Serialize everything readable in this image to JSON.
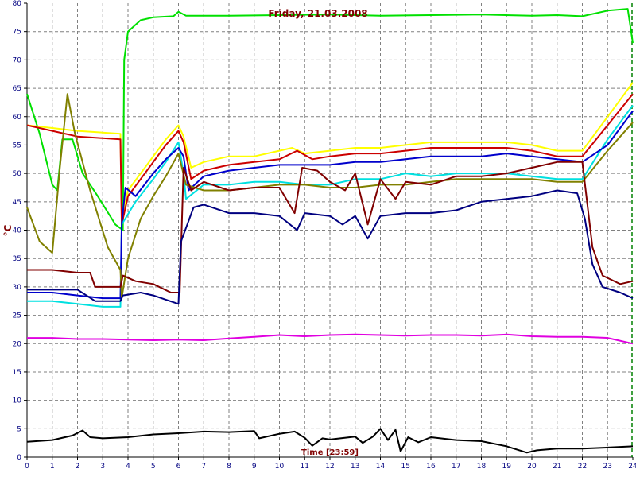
{
  "chart_data": {
    "type": "line",
    "title": "Friday, 21.03.2008",
    "xlabel": "Time [23:59]",
    "ylabel": "°C",
    "xlim": [
      0,
      24
    ],
    "ylim": [
      0,
      80
    ],
    "grid": true,
    "x_ticks": [
      "0",
      "1",
      "2",
      "3",
      "4",
      "5",
      "6",
      "7",
      "8",
      "9",
      "10",
      "11",
      "12",
      "13",
      "14",
      "15",
      "16",
      "17",
      "18",
      "19",
      "20",
      "21",
      "22",
      "23",
      "24"
    ],
    "y_ticks": [
      "0",
      "5",
      "10",
      "15",
      "20",
      "25",
      "30",
      "35",
      "40",
      "45",
      "50",
      "55",
      "60",
      "65",
      "70",
      "75",
      "80"
    ],
    "marker_x": 24,
    "series": [
      {
        "color": "#00e000",
        "points": [
          [
            0,
            64
          ],
          [
            0.5,
            57
          ],
          [
            1,
            48
          ],
          [
            1.2,
            47
          ],
          [
            1.4,
            56
          ],
          [
            1.8,
            56
          ],
          [
            2.2,
            50
          ],
          [
            2.8,
            46
          ],
          [
            3.5,
            41
          ],
          [
            3.8,
            40
          ],
          [
            3.85,
            70
          ],
          [
            4.0,
            75
          ],
          [
            4.5,
            77
          ],
          [
            5,
            77.5
          ],
          [
            5.8,
            77.7
          ],
          [
            6,
            78.5
          ],
          [
            6.3,
            77.8
          ],
          [
            8,
            77.8
          ],
          [
            10,
            77.9
          ],
          [
            12,
            78
          ],
          [
            14,
            77.8
          ],
          [
            16,
            77.9
          ],
          [
            18,
            78
          ],
          [
            20,
            77.8
          ],
          [
            21,
            77.9
          ],
          [
            22,
            77.7
          ],
          [
            23,
            78.7
          ],
          [
            23.8,
            79
          ],
          [
            24,
            73
          ]
        ]
      },
      {
        "color": "#ffff00",
        "points": [
          [
            0,
            58.5
          ],
          [
            1,
            58
          ],
          [
            2,
            57.5
          ],
          [
            3.7,
            57
          ],
          [
            3.75,
            42
          ],
          [
            4,
            47
          ],
          [
            4.5,
            50
          ],
          [
            5,
            53
          ],
          [
            5.5,
            56
          ],
          [
            6,
            58.5
          ],
          [
            6.2,
            56.5
          ],
          [
            6.5,
            51
          ],
          [
            7,
            52
          ],
          [
            8,
            53
          ],
          [
            9,
            53
          ],
          [
            10,
            54
          ],
          [
            10.5,
            54.5
          ],
          [
            11,
            53.5
          ],
          [
            12,
            54
          ],
          [
            13,
            54.5
          ],
          [
            14,
            54.5
          ],
          [
            15,
            55
          ],
          [
            16,
            55.5
          ],
          [
            17,
            55.5
          ],
          [
            18,
            55.5
          ],
          [
            19,
            55.5
          ],
          [
            20,
            55
          ],
          [
            21,
            54
          ],
          [
            22,
            54
          ],
          [
            23,
            60
          ],
          [
            24,
            66
          ]
        ]
      },
      {
        "color": "#cc0000",
        "points": [
          [
            0,
            58.5
          ],
          [
            1,
            57.5
          ],
          [
            2,
            56.5
          ],
          [
            3.7,
            56
          ],
          [
            3.75,
            41
          ],
          [
            4,
            46
          ],
          [
            4.5,
            49
          ],
          [
            5,
            52
          ],
          [
            5.5,
            55
          ],
          [
            6,
            57.5
          ],
          [
            6.2,
            55.5
          ],
          [
            6.5,
            49
          ],
          [
            7,
            50.5
          ],
          [
            8,
            51.5
          ],
          [
            9,
            52
          ],
          [
            10,
            52.5
          ],
          [
            10.7,
            54
          ],
          [
            11.3,
            52.5
          ],
          [
            12,
            53
          ],
          [
            13,
            53.5
          ],
          [
            14,
            53.5
          ],
          [
            15,
            54
          ],
          [
            16,
            54.5
          ],
          [
            17,
            54.5
          ],
          [
            18,
            54.5
          ],
          [
            19,
            54.5
          ],
          [
            20,
            54
          ],
          [
            21,
            53
          ],
          [
            22,
            53
          ],
          [
            23,
            58.5
          ],
          [
            24,
            64
          ]
        ]
      },
      {
        "color": "#00e0e0",
        "points": [
          [
            0,
            27.5
          ],
          [
            1,
            27.5
          ],
          [
            2,
            27
          ],
          [
            3,
            26.5
          ],
          [
            3.7,
            26.5
          ],
          [
            3.75,
            41
          ],
          [
            4.3,
            45
          ],
          [
            5,
            49
          ],
          [
            5.5,
            52
          ],
          [
            6,
            55.5
          ],
          [
            6.2,
            50
          ],
          [
            6.3,
            45.5
          ],
          [
            7,
            48
          ],
          [
            8,
            48
          ],
          [
            9,
            48.5
          ],
          [
            10,
            48.5
          ],
          [
            11,
            48
          ],
          [
            12,
            48
          ],
          [
            13,
            49
          ],
          [
            14,
            49
          ],
          [
            15,
            50
          ],
          [
            16,
            49.5
          ],
          [
            17,
            50
          ],
          [
            18,
            50
          ],
          [
            19,
            50
          ],
          [
            20,
            49.5
          ],
          [
            21,
            49
          ],
          [
            22,
            49
          ],
          [
            23,
            56
          ],
          [
            24,
            62
          ]
        ]
      },
      {
        "color": "#0000cc",
        "points": [
          [
            0,
            29
          ],
          [
            1,
            29
          ],
          [
            2,
            28.5
          ],
          [
            3,
            28
          ],
          [
            3.7,
            28
          ],
          [
            3.75,
            41
          ],
          [
            3.9,
            47.5
          ],
          [
            4.3,
            46
          ],
          [
            5,
            50
          ],
          [
            5.5,
            52.5
          ],
          [
            6,
            54.5
          ],
          [
            6.2,
            53
          ],
          [
            6.4,
            47
          ],
          [
            7,
            49.5
          ],
          [
            8,
            50.5
          ],
          [
            9,
            51
          ],
          [
            10,
            51.5
          ],
          [
            11,
            51.5
          ],
          [
            12,
            51.5
          ],
          [
            13,
            52
          ],
          [
            14,
            52
          ],
          [
            15,
            52.5
          ],
          [
            16,
            53
          ],
          [
            17,
            53
          ],
          [
            18,
            53
          ],
          [
            19,
            53.5
          ],
          [
            20,
            53
          ],
          [
            21,
            52.5
          ],
          [
            22,
            52
          ],
          [
            23,
            55
          ],
          [
            24,
            61
          ]
        ]
      },
      {
        "color": "#808000",
        "points": [
          [
            0,
            44
          ],
          [
            0.5,
            38
          ],
          [
            1,
            36
          ],
          [
            1.3,
            51
          ],
          [
            1.6,
            64
          ],
          [
            1.9,
            57
          ],
          [
            2.5,
            47
          ],
          [
            3.2,
            37
          ],
          [
            3.7,
            33
          ],
          [
            3.75,
            28
          ],
          [
            4,
            35
          ],
          [
            4.5,
            42
          ],
          [
            5,
            46
          ],
          [
            5.5,
            49.5
          ],
          [
            6,
            53.5
          ],
          [
            6.3,
            48
          ],
          [
            7,
            47
          ],
          [
            8,
            47
          ],
          [
            9,
            47.5
          ],
          [
            10,
            48
          ],
          [
            11,
            48
          ],
          [
            12,
            47.5
          ],
          [
            13,
            47.5
          ],
          [
            14,
            48
          ],
          [
            15,
            48
          ],
          [
            16,
            48.5
          ],
          [
            17,
            49
          ],
          [
            18,
            49
          ],
          [
            19,
            49
          ],
          [
            20,
            49
          ],
          [
            21,
            48.5
          ],
          [
            22,
            48.5
          ],
          [
            23,
            54
          ],
          [
            24,
            59
          ]
        ]
      },
      {
        "color": "#800000",
        "points": [
          [
            0,
            33
          ],
          [
            1,
            33
          ],
          [
            2,
            32.5
          ],
          [
            2.5,
            32.5
          ],
          [
            2.7,
            30
          ],
          [
            3.7,
            30
          ],
          [
            3.8,
            32
          ],
          [
            4.3,
            31
          ],
          [
            5,
            30.5
          ],
          [
            5.7,
            29
          ],
          [
            6.05,
            29
          ],
          [
            6.2,
            51
          ],
          [
            6.5,
            47
          ],
          [
            7,
            48.5
          ],
          [
            8,
            47
          ],
          [
            9,
            47.5
          ],
          [
            10,
            47.5
          ],
          [
            10.6,
            43
          ],
          [
            10.9,
            51
          ],
          [
            11.5,
            50.5
          ],
          [
            12,
            48.5
          ],
          [
            12.6,
            47
          ],
          [
            13,
            50
          ],
          [
            13.5,
            41
          ],
          [
            14,
            49
          ],
          [
            14.6,
            45.5
          ],
          [
            15,
            48.5
          ],
          [
            16,
            48
          ],
          [
            17,
            49.5
          ],
          [
            18,
            49.5
          ],
          [
            19,
            50
          ],
          [
            20,
            51
          ],
          [
            21,
            52
          ],
          [
            22,
            52
          ],
          [
            22.4,
            37
          ],
          [
            22.8,
            32
          ],
          [
            23.5,
            30.5
          ],
          [
            24,
            31
          ]
        ]
      },
      {
        "color": "#000080",
        "points": [
          [
            0,
            29.5
          ],
          [
            1,
            29.5
          ],
          [
            2,
            29.5
          ],
          [
            2.7,
            27.5
          ],
          [
            3.7,
            27.5
          ],
          [
            3.8,
            28.5
          ],
          [
            4.5,
            29
          ],
          [
            5,
            28.5
          ],
          [
            6,
            27
          ],
          [
            6.1,
            38
          ],
          [
            6.6,
            44
          ],
          [
            7,
            44.5
          ],
          [
            8,
            43
          ],
          [
            9,
            43
          ],
          [
            10,
            42.5
          ],
          [
            10.7,
            40
          ],
          [
            11,
            43
          ],
          [
            12,
            42.5
          ],
          [
            12.5,
            41
          ],
          [
            13,
            42.5
          ],
          [
            13.5,
            38.5
          ],
          [
            14,
            42.5
          ],
          [
            15,
            43
          ],
          [
            16,
            43
          ],
          [
            17,
            43.5
          ],
          [
            18,
            45
          ],
          [
            19,
            45.5
          ],
          [
            20,
            46
          ],
          [
            21,
            47
          ],
          [
            21.8,
            46.5
          ],
          [
            22.1,
            42
          ],
          [
            22.4,
            34
          ],
          [
            22.8,
            30
          ],
          [
            23.5,
            29
          ],
          [
            24,
            28
          ]
        ]
      },
      {
        "color": "#e000e0",
        "points": [
          [
            0,
            21
          ],
          [
            1,
            21
          ],
          [
            2,
            20.8
          ],
          [
            3,
            20.8
          ],
          [
            4,
            20.7
          ],
          [
            5,
            20.6
          ],
          [
            6,
            20.7
          ],
          [
            7,
            20.6
          ],
          [
            8,
            20.9
          ],
          [
            9,
            21.2
          ],
          [
            10,
            21.5
          ],
          [
            11,
            21.3
          ],
          [
            12,
            21.5
          ],
          [
            13,
            21.6
          ],
          [
            14,
            21.5
          ],
          [
            15,
            21.4
          ],
          [
            16,
            21.5
          ],
          [
            17,
            21.5
          ],
          [
            18,
            21.4
          ],
          [
            19,
            21.6
          ],
          [
            20,
            21.3
          ],
          [
            21,
            21.2
          ],
          [
            22,
            21.2
          ],
          [
            23,
            21
          ],
          [
            24,
            20
          ]
        ]
      },
      {
        "color": "#000000",
        "points": [
          [
            0,
            2.7
          ],
          [
            1,
            3
          ],
          [
            1.8,
            3.8
          ],
          [
            2.2,
            4.7
          ],
          [
            2.5,
            3.5
          ],
          [
            3,
            3.3
          ],
          [
            4,
            3.5
          ],
          [
            5,
            4
          ],
          [
            6,
            4.2
          ],
          [
            7,
            4.5
          ],
          [
            8,
            4.4
          ],
          [
            9,
            4.6
          ],
          [
            9.2,
            3.3
          ],
          [
            10,
            4.1
          ],
          [
            10.6,
            4.5
          ],
          [
            11,
            3.4
          ],
          [
            11.3,
            2
          ],
          [
            11.7,
            3.3
          ],
          [
            12,
            3.1
          ],
          [
            13,
            3.6
          ],
          [
            13.3,
            2.5
          ],
          [
            13.7,
            3.6
          ],
          [
            14,
            5
          ],
          [
            14.3,
            3
          ],
          [
            14.6,
            4.8
          ],
          [
            14.8,
            1
          ],
          [
            15.1,
            3.5
          ],
          [
            15.5,
            2.6
          ],
          [
            16,
            3.5
          ],
          [
            17,
            3
          ],
          [
            18,
            2.8
          ],
          [
            19,
            1.9
          ],
          [
            19.8,
            0.8
          ],
          [
            20.2,
            1.2
          ],
          [
            21,
            1.5
          ],
          [
            22,
            1.5
          ],
          [
            23,
            1.7
          ],
          [
            24,
            1.9
          ]
        ]
      }
    ]
  }
}
